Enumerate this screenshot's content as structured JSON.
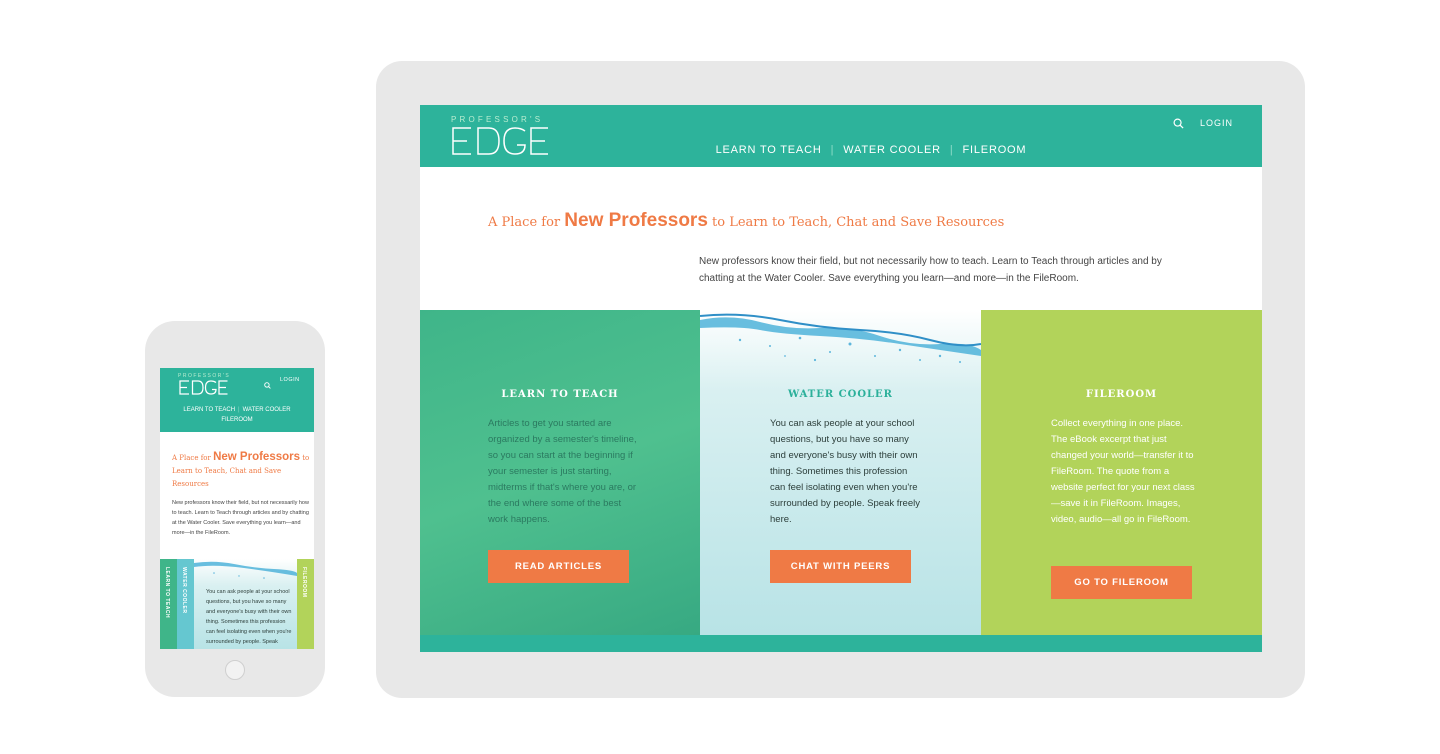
{
  "brand": {
    "logo_top": "PROFESSOR'S",
    "logo_main": "EDGE",
    "primary_color": "#2db39b",
    "accent_color": "#ef7a45",
    "green_panel": "#b2d35a"
  },
  "header": {
    "login": "LOGIN",
    "search_icon": "search-icon"
  },
  "nav": {
    "items": [
      "LEARN TO TEACH",
      "WATER COOLER",
      "FILEROOM"
    ],
    "separator": "|"
  },
  "intro": {
    "title_prefix": "A Place for ",
    "title_emphasis": "New Professors",
    "title_suffix": " to Learn to Teach, Chat and Save Resources",
    "body": "New professors know their field, but not necessarily how to teach. Learn to Teach through articles and by chatting at the Water Cooler. Save everything you learn—and more—in the FileRoom."
  },
  "panels": [
    {
      "title": "LEARN TO TEACH",
      "text": "Articles to get you started are organized by a semester's timeline, so you can start at the beginning if your semester is just starting, midterms if that's where you are, or the end where some of the best work happens.",
      "button": "READ ARTICLES"
    },
    {
      "title": "WATER COOLER",
      "text": "You can ask people at your school questions, but you have so many and everyone's busy with their own thing. Sometimes this profession can feel isolating even when you're surrounded by people. Speak freely here.",
      "button": "CHAT WITH PEERS"
    },
    {
      "title": "FILEROOM",
      "text": "Collect everything in one place. The eBook excerpt that just changed your world—transfer it to FileRoom. The quote from a website perfect for your next class—save it in FileRoom. Images, video, audio—all go in FileRoom.",
      "button": "GO TO FILEROOM"
    }
  ],
  "mobile": {
    "login": "LOGIN",
    "nav_line1_a": "LEARN TO TEACH",
    "nav_line1_b": "WATER COOLER",
    "nav_line2": "FILEROOM",
    "title_prefix": "A Place for ",
    "title_emphasis": "New Professors",
    "title_suffix": " to Learn to Teach, Chat and Save Resources",
    "body": "New professors know their field, but not necessarily how to teach. Learn to Teach through articles and by chatting at the Water Cooler. Save everything you learn—and more—in the FileRoom.",
    "tab1": "LEARN TO TEACH",
    "tab2": "WATER COOLER",
    "tab3": "FILEROOM",
    "panel_text": "You can ask people at your school questions, but you have so many and everyone's busy with their own thing. Sometimes this profession can feel isolating even when you're surrounded by people. Speak"
  }
}
